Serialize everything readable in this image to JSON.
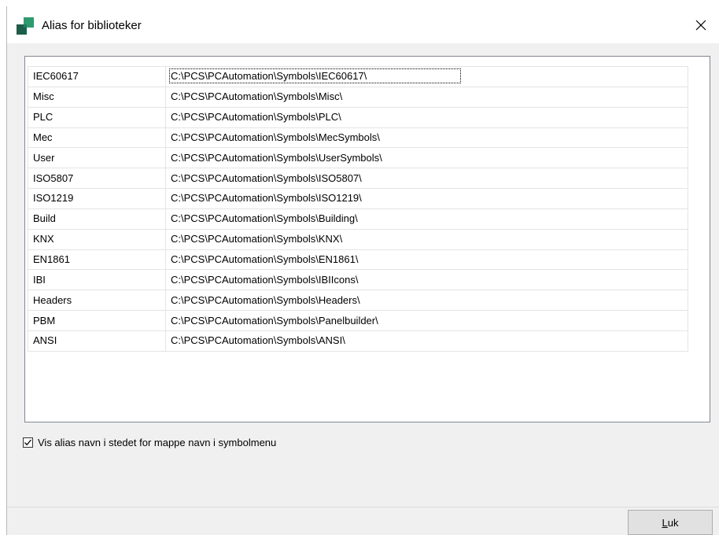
{
  "window": {
    "title": "Alias for biblioteker",
    "icons": {
      "app": "app-logo-icon",
      "close": "close-icon"
    }
  },
  "aliases": [
    {
      "alias": "IEC60617",
      "path": "C:\\PCS\\PCAutomation\\Symbols\\IEC60617\\"
    },
    {
      "alias": "Misc",
      "path": "C:\\PCS\\PCAutomation\\Symbols\\Misc\\"
    },
    {
      "alias": "PLC",
      "path": "C:\\PCS\\PCAutomation\\Symbols\\PLC\\"
    },
    {
      "alias": "Mec",
      "path": "C:\\PCS\\PCAutomation\\Symbols\\MecSymbols\\"
    },
    {
      "alias": "User",
      "path": "C:\\PCS\\PCAutomation\\Symbols\\UserSymbols\\"
    },
    {
      "alias": "ISO5807",
      "path": "C:\\PCS\\PCAutomation\\Symbols\\ISO5807\\"
    },
    {
      "alias": "ISO1219",
      "path": "C:\\PCS\\PCAutomation\\Symbols\\ISO1219\\"
    },
    {
      "alias": "Build",
      "path": "C:\\PCS\\PCAutomation\\Symbols\\Building\\"
    },
    {
      "alias": "KNX",
      "path": "C:\\PCS\\PCAutomation\\Symbols\\KNX\\"
    },
    {
      "alias": "EN1861",
      "path": "C:\\PCS\\PCAutomation\\Symbols\\EN1861\\"
    },
    {
      "alias": "IBI",
      "path": "C:\\PCS\\PCAutomation\\Symbols\\IBIIcons\\"
    },
    {
      "alias": "Headers",
      "path": "C:\\PCS\\PCAutomation\\Symbols\\Headers\\"
    },
    {
      "alias": "PBM",
      "path": "C:\\PCS\\PCAutomation\\Symbols\\Panelbuilder\\"
    },
    {
      "alias": "ANSI",
      "path": "C:\\PCS\\PCAutomation\\Symbols\\ANSI\\"
    }
  ],
  "options": {
    "show_alias_label": "Vis alias navn i stedet for mappe navn i symbolmenu",
    "show_alias_checked": true
  },
  "buttons": {
    "close_mnemonic": "L",
    "close_rest": "uk"
  },
  "colors": {
    "logo_dark": "#1b5e4a",
    "logo_light": "#2f9a6e",
    "window_bg": "#f0f0f0"
  }
}
